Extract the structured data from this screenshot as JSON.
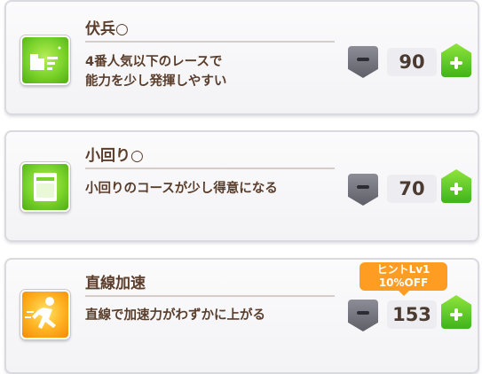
{
  "skills": [
    {
      "title": "伏兵○",
      "description_lines": [
        "4番人気以下のレースで",
        "能力を少し発揮しやすい"
      ],
      "value": "90",
      "icon": "gear-speed-icon",
      "icon_color": "#7ad22a"
    },
    {
      "title": "小回り○",
      "description_lines": [
        "小回りのコースが少し得意になる"
      ],
      "value": "70",
      "icon": "document-icon",
      "icon_color": "#7ad22a"
    },
    {
      "title": "直線加速",
      "description_lines": [
        "直線で加速力がわずかに上がる"
      ],
      "value": "153",
      "icon": "running-figure-icon",
      "icon_color": "#ffb020",
      "hint": {
        "line1": "ヒントLv1",
        "line2": "10%OFF"
      }
    }
  ],
  "colors": {
    "accent_green": "#3fb41a",
    "minus_gray": "#5f5f68",
    "hint_orange": "#ff9d22",
    "text_brown": "#5a3d2a"
  }
}
